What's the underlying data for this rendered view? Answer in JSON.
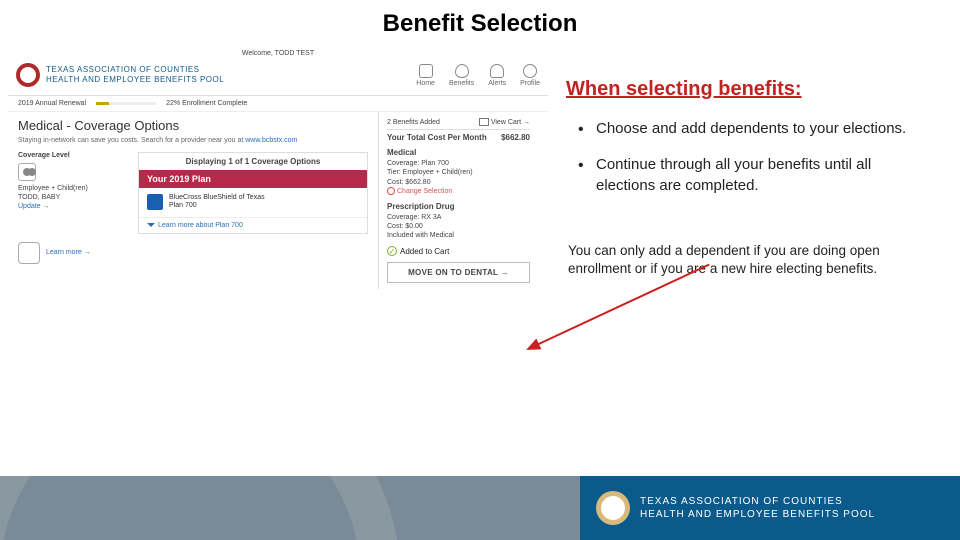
{
  "slide": {
    "title": "Benefit Selection",
    "right_heading": "When selecting benefits:",
    "bullets": [
      "Choose and add dependents to your elections.",
      "Continue through all your benefits until all elections are completed."
    ],
    "note": "You can only add a dependent if you are doing open enrollment or if you are a new hire electing benefits."
  },
  "app": {
    "welcome": "Welcome, TODD TEST",
    "brand_line1": "TEXAS ASSOCIATION OF COUNTIES",
    "brand_line2": "HEALTH AND EMPLOYEE BENEFITS POOL",
    "nav": {
      "home": "Home",
      "benefits": "Benefits",
      "alerts": "Alerts",
      "profile": "Profile"
    },
    "progress": {
      "left": "2019 Annual Renewal",
      "right": "22% Enrollment Complete"
    },
    "section_title": "Medical - Coverage Options",
    "subtext_prefix": "Staying in-network can save you costs. Search for a provider near you at ",
    "subtext_link": "www.bcbstx.com",
    "displaying": "Displaying 1 of 1 Coverage Options",
    "coverage": {
      "label": "Coverage Level",
      "tier": "Employee + Child(ren)",
      "name": "TODD, BABY",
      "update": "Update →"
    },
    "plan": {
      "banner": "Your 2019 Plan",
      "carrier": "BlueCross BlueShield of Texas",
      "name": "Plan 700",
      "learn": "Learn more about Plan 700"
    },
    "brain_link": "Learn more →",
    "cart": {
      "count_label": "2   Benefits Added",
      "view": "View Cart →",
      "total_label": "Your Total Cost Per Month",
      "total_value": "$662.80",
      "medical": {
        "head": "Medical",
        "coverage": "Coverage:  Plan 700",
        "tier": "Tier: Employee + Child(ren)",
        "cost": "Cost:  $662.80",
        "change": "Change Selection"
      },
      "rx": {
        "head": "Prescription Drug",
        "coverage": "Coverage:  RX 3A",
        "cost": "Cost: $0.00",
        "incl": "Included with Medical"
      },
      "added": "Added to Cart",
      "move_on": "MOVE ON TO DENTAL →"
    }
  },
  "footer": {
    "brand_line1": "TEXAS ASSOCIATION OF COUNTIES",
    "brand_line2": "HEALTH AND EMPLOYEE BENEFITS POOL"
  }
}
